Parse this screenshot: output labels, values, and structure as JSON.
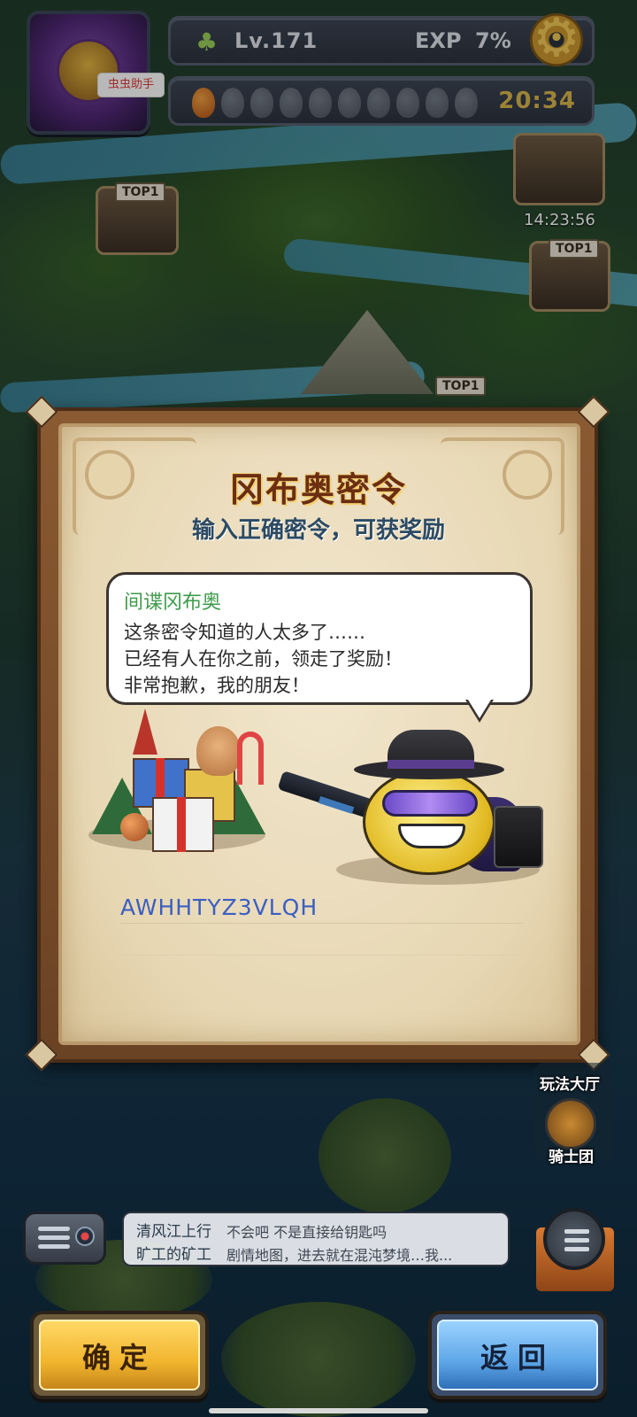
{
  "hud": {
    "helper_badge": "虫虫助手",
    "level": "Lv.171",
    "exp_label": "EXP",
    "exp_value": "7%",
    "energy_full": 1,
    "energy_total": 10,
    "timer": "20:34"
  },
  "map": {
    "markers": [
      {
        "tag": "TOP1",
        "region": "left"
      },
      {
        "tag": "TOP1",
        "region": "right"
      },
      {
        "tag": "TOP1",
        "region": "center"
      }
    ],
    "event_time": "14:23:56",
    "side_menu": {
      "play_hall": "玩法大厅",
      "knights": "骑士团"
    }
  },
  "dialog": {
    "title": "冈布奥密令",
    "subtitle": "输入正确密令，可获奖励",
    "speaker": "间谍冈布奥",
    "lines": [
      "这条密令知道的人太多了……",
      "已经有人在你之前，领走了奖励！",
      "非常抱歉，我的朋友！"
    ],
    "code_value": "AWHHTYZ3VLQH"
  },
  "chat": {
    "messages": [
      {
        "name": "清风江上行",
        "text": "不会吧 不是直接给钥匙吗"
      },
      {
        "name": "旷工的矿工",
        "text": "剧情地图，进去就在混沌梦境…我..."
      }
    ]
  },
  "buttons": {
    "confirm": "确定",
    "back": "返回"
  },
  "colors": {
    "confirm_button": "#f1b52e",
    "back_button": "#5ea6e8",
    "title_text": "#6b2e12",
    "speaker_text": "#3e9a4a",
    "code_text": "#3b5ec2"
  }
}
